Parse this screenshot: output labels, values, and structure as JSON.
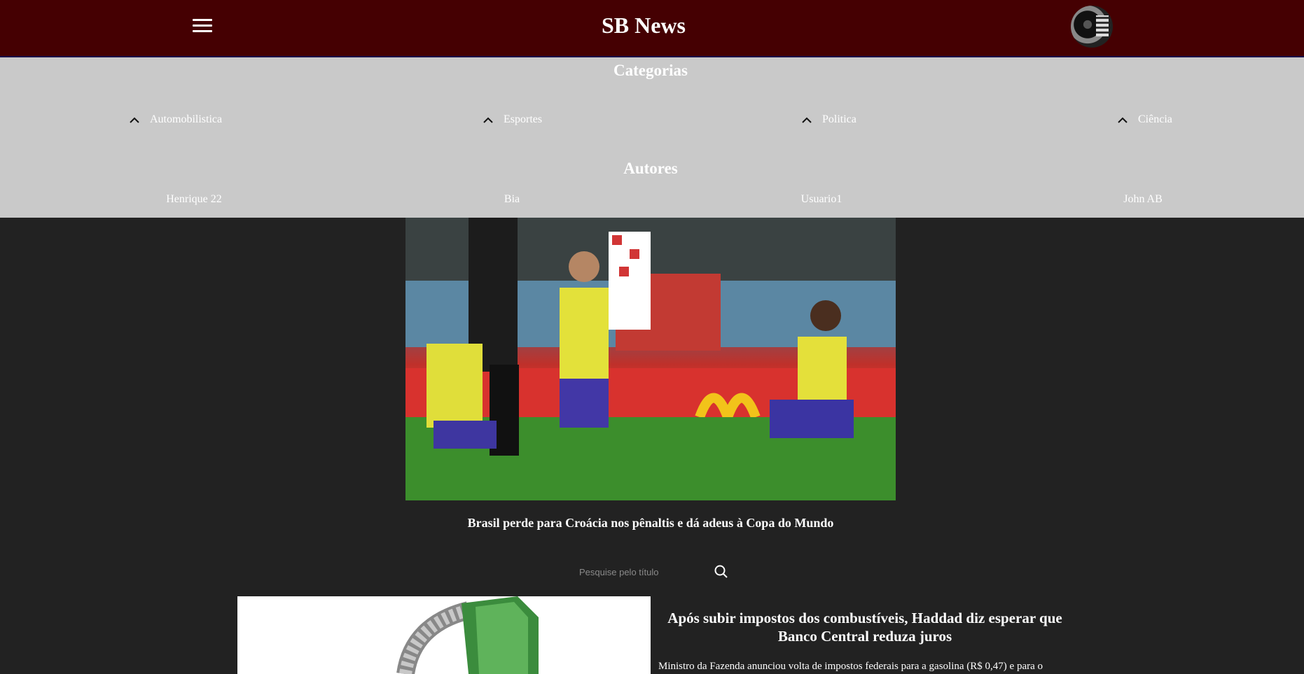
{
  "header": {
    "title": "SB News",
    "menu_icon": "hamburger-menu-icon",
    "avatar_icon": "user-avatar"
  },
  "menu": {
    "categories_title": "Categorias",
    "categories": [
      {
        "label": "Automobilistica",
        "icon": "chevron-up-icon"
      },
      {
        "label": "Esportes",
        "icon": "chevron-up-icon"
      },
      {
        "label": "Politica",
        "icon": "chevron-up-icon"
      },
      {
        "label": "Ciência",
        "icon": "chevron-up-icon"
      }
    ],
    "authors_title": "Autores",
    "authors": [
      "Henrique 22",
      "Bia",
      "Usuario1",
      "John AB"
    ]
  },
  "featured": {
    "caption": "Brasil perde para Croácia nos pênaltis e dá adeus à Copa do Mundo"
  },
  "search": {
    "placeholder": "Pesquise pelo título",
    "icon": "search-icon"
  },
  "articles": [
    {
      "title": "Após subir impostos dos combustíveis, Haddad diz esperar que Banco Central reduza juros",
      "summary": "Ministro da Fazenda anunciou volta de impostos federais para a gasolina (R$ 0,47) e para o"
    }
  ],
  "colors": {
    "header_bg": "#450002",
    "page_bg": "#222222",
    "dropdown_bg": "#c9c9c9"
  }
}
